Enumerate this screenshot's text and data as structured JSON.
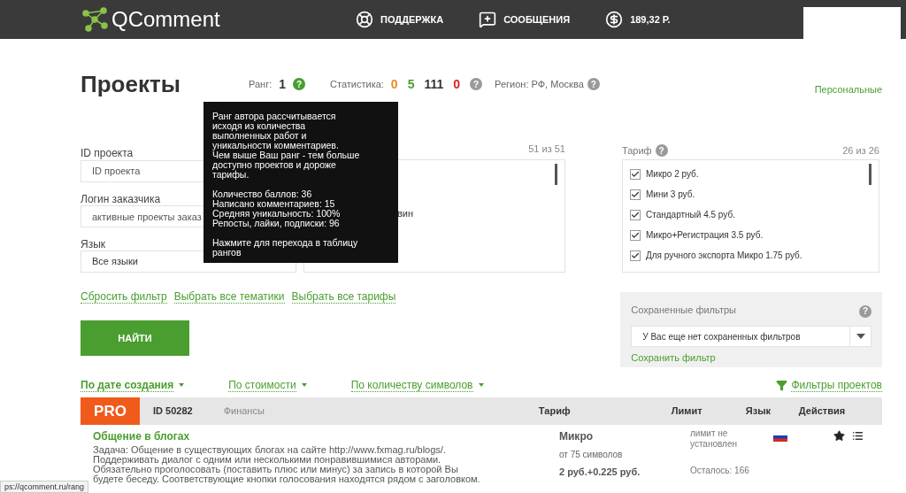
{
  "header": {
    "logo": "QComment",
    "nav": [
      {
        "kind": "support",
        "label": "ПОДДЕРЖКА"
      },
      {
        "kind": "messages",
        "label": "СООБЩЕНИЯ"
      },
      {
        "kind": "balance",
        "label": "189,32 Р."
      }
    ]
  },
  "page_title": "Проекты",
  "help_mark": "?",
  "stats": {
    "rank_label": "Ранг:",
    "rank": "1",
    "stat_label": "Статистика:",
    "values": [
      {
        "text": "0",
        "color": "#f08a24"
      },
      {
        "text": "5",
        "color": "#4a9e2f"
      },
      {
        "text": "111",
        "color": "#333333"
      },
      {
        "text": "0",
        "color": "#e02020"
      }
    ],
    "region": "Регион: РФ, Москва",
    "personal_link": "Персональные"
  },
  "filters": {
    "fields": [
      {
        "label": "ID проекта",
        "placeholder": "ID проекта"
      },
      {
        "label": "Логин заказчика",
        "placeholder": "активные проекты заказ"
      },
      {
        "label": "Язык",
        "value": "Все языки"
      }
    ],
    "topics_count": "51 из 51",
    "topics_visible": [
      "вин"
    ],
    "links": [
      "Сбросить фильтр",
      "Выбрать все тематики",
      "Выбрать все тарифы"
    ],
    "search_button": "НАЙТИ"
  },
  "tooltip": {
    "paragraphs": [
      "Ранг автора рассчитывается\nисходя из количества\nвыполненных работ и\nуникальности комментариев.\nЧем выше Ваш ранг - тем больше\nдоступно проектов и дороже\nтарифы.",
      "Количество баллов: 36\nНаписано комментариев: 15\nСредняя уникальность: 100%\nРепосты, лайки, подписки: 96",
      "Нажмите для перехода в таблицу\nрангов"
    ]
  },
  "tariffs": {
    "label": "Тариф",
    "count": "26 из 26",
    "items": [
      {
        "label": "Микро 2 руб.",
        "checked": true
      },
      {
        "label": "Мини 3 руб.",
        "checked": true
      },
      {
        "label": "Стандартный 4.5 руб.",
        "checked": true
      },
      {
        "label": "Микро+Регистрация 3.5 руб.",
        "checked": true
      },
      {
        "label": "Для ручного экспорта Микро 1.75 руб.",
        "checked": true
      }
    ]
  },
  "saved_filters": {
    "label": "Сохраненные фильтры",
    "value": "У Вас еще нет сохраненных фильтров",
    "save_link": "Сохранить фильтр"
  },
  "sort": {
    "options": [
      {
        "label": "По дате создания",
        "selected": true
      },
      {
        "label": "По стоимости",
        "selected": false
      },
      {
        "label": "По количеству символов",
        "selected": false
      }
    ],
    "filters_link": "Фильтры проектов"
  },
  "table": {
    "badge": "PRO",
    "id": "ID 50282",
    "category": "Финансы",
    "columns": [
      "Тариф",
      "Лимит",
      "Язык",
      "Действия"
    ],
    "rows": [
      {
        "title": "Общение в блогах",
        "description": "Задача: Общение в существующих блогах на сайте http://www.fxmag.ru/blogs/.\nПоддерживать диалог с одним или несколькими понравившимися авторами.\nОбязательно проголосовать (поставить плюс или минус) за запись в которой Вы\nбудете беседу. Соответствующие кнопки голосования находятся рядом с заголовком.",
        "tariff": "Микро",
        "min_chars": "от 75 символов",
        "price": "2 руб.+0.225 руб.",
        "limit": "лимит не установлен",
        "remaining": "Осталось: 166"
      }
    ]
  },
  "status_url": "ps://qcomment.ru/rang"
}
